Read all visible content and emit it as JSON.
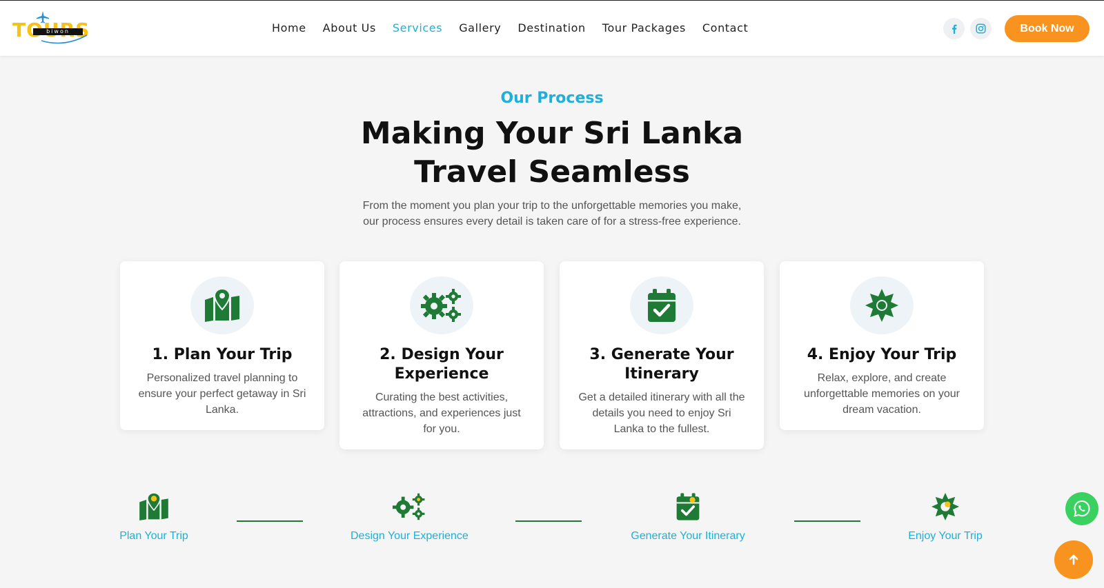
{
  "brand": {
    "logo_text": "TOURS",
    "logo_bar_text": "biwon",
    "logo_color": "#f5c219"
  },
  "nav": {
    "items": [
      {
        "label": "Home",
        "active": false
      },
      {
        "label": "About Us",
        "active": false
      },
      {
        "label": "Services",
        "active": true
      },
      {
        "label": "Gallery",
        "active": false
      },
      {
        "label": "Destination",
        "active": false
      },
      {
        "label": "Tour Packages",
        "active": false
      },
      {
        "label": "Contact",
        "active": false
      }
    ],
    "active_color": "#1eb0d8"
  },
  "header": {
    "social_icons": [
      "facebook-icon",
      "instagram-icon"
    ],
    "book_label": "Book Now",
    "book_color": "#f7931e"
  },
  "section": {
    "eyebrow": "Our Process",
    "title_line1": "Making Your Sri Lanka",
    "title_line2": "Travel Seamless",
    "subtitle_line1": "From the moment you plan your trip to the unforgettable memories you make,",
    "subtitle_line2": "our process ensures every detail is taken care of for a stress-free experience."
  },
  "cards": [
    {
      "icon": "map-pin-icon",
      "title_lines": [
        "1. Plan Your Trip"
      ],
      "text_lines": [
        "Personalized travel planning to",
        "ensure your perfect getaway in Sri",
        "Lanka."
      ]
    },
    {
      "icon": "gears-icon",
      "title_lines": [
        "2. Design Your",
        "Experience"
      ],
      "text_lines": [
        "Curating the best activities,",
        "attractions, and experiences just",
        "for you."
      ]
    },
    {
      "icon": "calendar-check-icon",
      "title_lines": [
        "3. Generate Your",
        "Itinerary"
      ],
      "text_lines": [
        "Get a detailed itinerary with all the",
        "details you need to enjoy Sri",
        "Lanka to the fullest."
      ]
    },
    {
      "icon": "sun-icon",
      "title_lines": [
        "4. Enjoy Your Trip"
      ],
      "text_lines": [
        "Relax, explore, and create",
        "unforgettable memories on your",
        "dream vacation."
      ]
    }
  ],
  "steps": [
    {
      "icon": "map-pin-icon",
      "label": "Plan Your Trip"
    },
    {
      "icon": "gears-icon",
      "label": "Design Your Experience"
    },
    {
      "icon": "calendar-check-icon",
      "label": "Generate Your Itinerary"
    },
    {
      "icon": "sun-icon",
      "label": "Enjoy Your Trip"
    }
  ],
  "floating": {
    "whatsapp_icon": "whatsapp-icon",
    "to_top_icon": "arrow-up-icon"
  },
  "colors": {
    "icon_green": "#1f7a35",
    "step_dot": "#f5c219",
    "whatsapp": "#3bd160"
  }
}
